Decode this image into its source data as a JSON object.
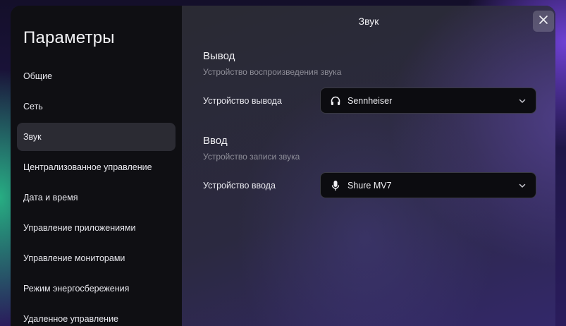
{
  "sidebar": {
    "title": "Параметры",
    "items": [
      {
        "label": "Общие"
      },
      {
        "label": "Сеть"
      },
      {
        "label": "Звук",
        "active": true
      },
      {
        "label": "Централизованное управление"
      },
      {
        "label": "Дата и время"
      },
      {
        "label": "Управление приложениями"
      },
      {
        "label": "Управление мониторами"
      },
      {
        "label": "Режим энергосбережения"
      },
      {
        "label": "Удаленное управление"
      }
    ]
  },
  "content": {
    "title": "Звук",
    "close_icon": "close-icon",
    "output": {
      "title": "Вывод",
      "subtitle": "Устройство воспроизведения звука",
      "label": "Устройство вывода",
      "value": "Sennheiser",
      "icon": "headphones-icon"
    },
    "input": {
      "title": "Ввод",
      "subtitle": "Устройство записи звука",
      "label": "Устройство ввода",
      "value": "Shure MV7",
      "icon": "microphone-icon"
    }
  },
  "colors": {
    "sidebar_bg": "#0f0f13",
    "active_item_bg": "#2b2b33",
    "select_bg": "#0c0c10"
  }
}
